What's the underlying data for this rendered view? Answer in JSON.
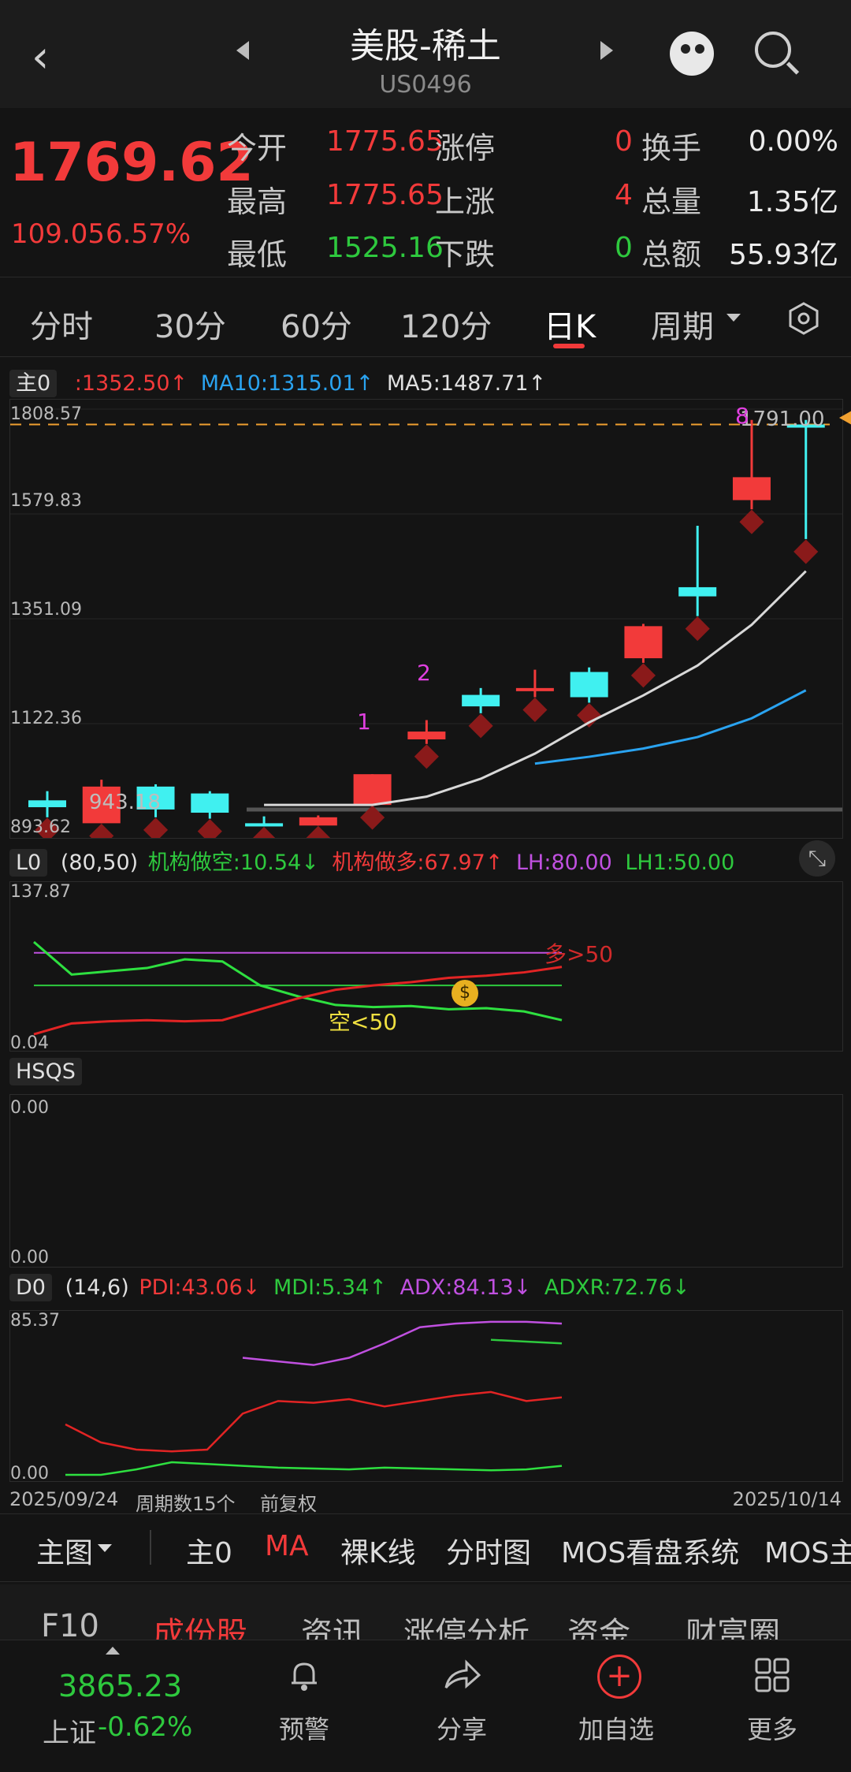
{
  "header": {
    "title": "美股-稀土",
    "code": "US0496"
  },
  "quote": {
    "price": "1769.62",
    "change": "109.05",
    "change_pct": "6.57%",
    "open_label": "今开",
    "open": "1775.65",
    "high_label": "最高",
    "high": "1775.65",
    "low_label": "最低",
    "low": "1525.16",
    "limit_up_label": "涨停",
    "limit_up": "0",
    "rise_label": "上涨",
    "rise": "4",
    "fall_label": "下跌",
    "fall": "0",
    "turnover_label": "换手",
    "turnover": "0.00%",
    "volume_label": "总量",
    "volume": "1.35亿",
    "amount_label": "总额",
    "amount": "55.93亿"
  },
  "tabs": [
    "分时",
    "30分",
    "60分",
    "120分",
    "日K",
    "周期"
  ],
  "main_chart": {
    "selector": "主0",
    "ma_value": ":1352.50↑",
    "ma10": "MA10:1315.01↑",
    "ma5": "MA5:1487.71↑",
    "y_ticks": [
      "1808.57",
      "1579.83",
      "1351.09",
      "1122.36",
      "893.62"
    ],
    "low_marker": "943.18",
    "high_marker": "1791.00",
    "labels": [
      "1",
      "2",
      "8"
    ]
  },
  "lo_panel": {
    "selector": "L0",
    "params": "(80,50)",
    "short": "机构做空:10.54↓",
    "long": "机构做多:67.97↑",
    "lh": "LH:80.00",
    "lh1": "LH1:50.00",
    "y_top": "137.87",
    "y_bottom": "0.04",
    "ann_long": "多>50",
    "ann_short": "空<50"
  },
  "hsqs_panel": {
    "selector": "HSQS",
    "y_top": "0.00",
    "y_bottom": "0.00"
  },
  "do_panel": {
    "selector": "D0",
    "params": "(14,6)",
    "pdi": "PDI:43.06↓",
    "mdi": "MDI:5.34↑",
    "adx": "ADX:84.13↓",
    "adxr": "ADXR:72.76↓",
    "y_top": "85.37",
    "y_bottom": "0.00"
  },
  "x_axis": {
    "start": "2025/09/24",
    "count": "周期数15个",
    "adj": "前复权",
    "end": "2025/10/14"
  },
  "modebar": [
    "主图",
    "主0",
    "MA",
    "裸K线",
    "分时图",
    "MOS看盘系统",
    "MOS主"
  ],
  "f10_tabs": [
    "F10",
    "成份股",
    "资讯",
    "涨停分析",
    "资金",
    "财富圈"
  ],
  "bottom_nav": {
    "index_value": "3865.23",
    "index_name": "上证",
    "index_change": "-0.62%",
    "items": [
      "预警",
      "分享",
      "加自选",
      "更多"
    ]
  },
  "colors": {
    "up": "#f23a3a",
    "down": "#40f0f0",
    "ma5": "#d8d8d8",
    "ma10": "#2aa3f0",
    "accent": "#f23a3a"
  },
  "chart_data": {
    "type": "candlestick",
    "candles": [
      {
        "o": 940,
        "h": 975,
        "l": 918,
        "c": 955,
        "up": false
      },
      {
        "o": 905,
        "h": 1000,
        "l": 905,
        "c": 985,
        "up": true
      },
      {
        "o": 985,
        "h": 990,
        "l": 918,
        "c": 935,
        "up": false
      },
      {
        "o": 970,
        "h": 975,
        "l": 915,
        "c": 928,
        "up": false
      },
      {
        "o": 905,
        "h": 920,
        "l": 898,
        "c": 898,
        "up": false
      },
      {
        "o": 900,
        "h": 922,
        "l": 900,
        "c": 918,
        "up": true
      },
      {
        "o": 945,
        "h": 1012,
        "l": 945,
        "c": 1012,
        "up": true
      },
      {
        "o": 1088,
        "h": 1130,
        "l": 1078,
        "c": 1105,
        "up": true
      },
      {
        "o": 1185,
        "h": 1200,
        "l": 1145,
        "c": 1160,
        "up": false
      },
      {
        "o": 1195,
        "h": 1240,
        "l": 1180,
        "c": 1200,
        "up": true
      },
      {
        "o": 1235,
        "h": 1245,
        "l": 1168,
        "c": 1180,
        "up": false
      },
      {
        "o": 1265,
        "h": 1340,
        "l": 1255,
        "c": 1335,
        "up": true
      },
      {
        "o": 1420,
        "h": 1554,
        "l": 1357,
        "c": 1400,
        "up": false
      },
      {
        "o": 1610,
        "h": 1785,
        "l": 1590,
        "c": 1660,
        "up": true
      },
      {
        "o": 1775,
        "h": 1785,
        "l": 1525,
        "c": 1770,
        "up": false
      }
    ],
    "ma5": [
      null,
      null,
      null,
      null,
      945,
      945,
      945,
      963,
      1002,
      1057,
      1125,
      1184,
      1249,
      1338,
      1455
    ],
    "ma10": [
      null,
      null,
      null,
      null,
      null,
      null,
      null,
      null,
      null,
      1035,
      1050,
      1068,
      1093,
      1134,
      1195
    ]
  }
}
